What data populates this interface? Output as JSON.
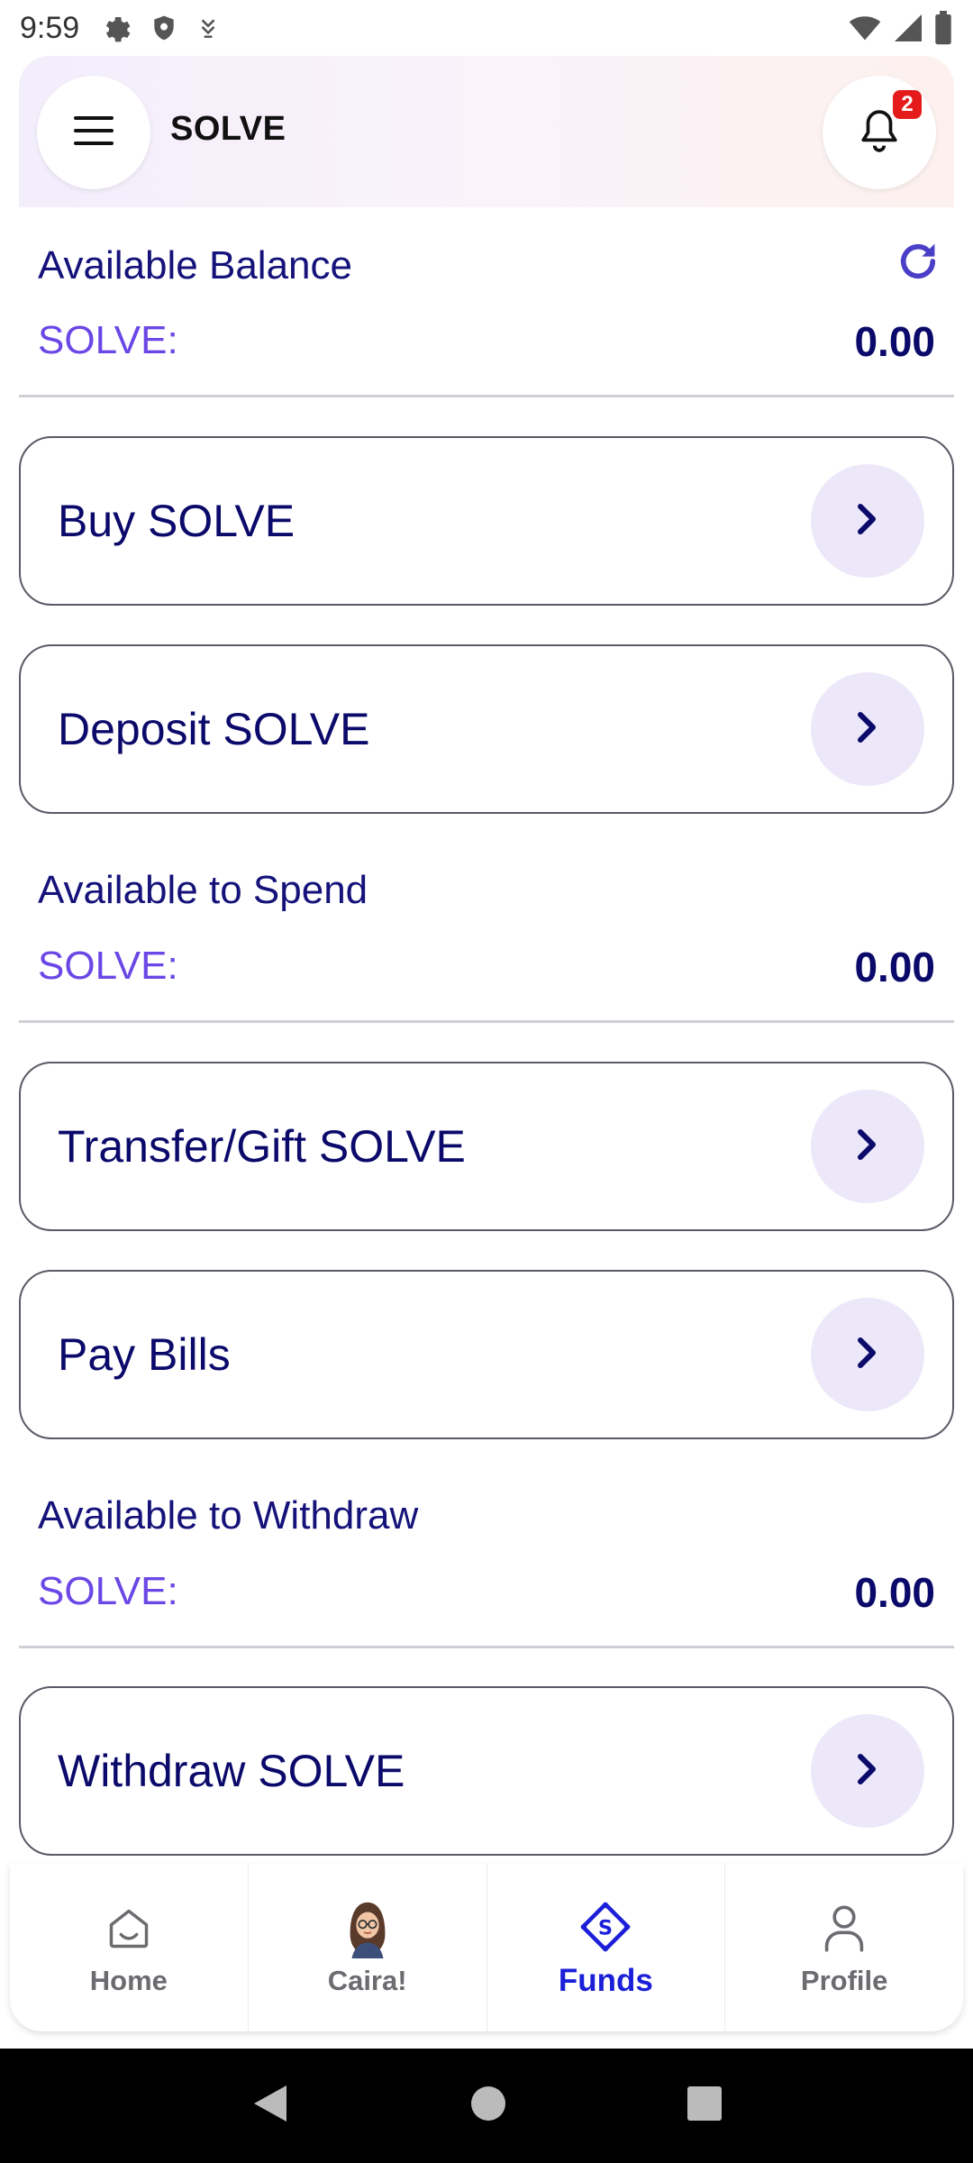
{
  "status_bar": {
    "time": "9:59",
    "left_icons": [
      "settings-icon",
      "shield-icon",
      "download-icon"
    ],
    "right_icons": [
      "wifi-icon",
      "signal-icon",
      "battery-icon"
    ]
  },
  "header": {
    "title": "SOLVE",
    "notification_count": "2",
    "menu_icon": "hamburger-menu-icon",
    "bell_icon": "bell-icon"
  },
  "sections": {
    "available_balance": {
      "title": "Available Balance",
      "currency": "SOLVE:",
      "value": "0.00"
    },
    "available_to_spend": {
      "title": "Available to Spend",
      "currency": "SOLVE:",
      "value": "0.00"
    },
    "available_to_withdraw": {
      "title": "Available to Withdraw",
      "currency": "SOLVE:",
      "value": "0.00"
    }
  },
  "actions": {
    "buy": "Buy SOLVE",
    "deposit": "Deposit SOLVE",
    "transfer": "Transfer/Gift SOLVE",
    "pay_bills": "Pay Bills",
    "withdraw": "Withdraw SOLVE"
  },
  "bottom_nav": {
    "home": "Home",
    "caira": "Caira!",
    "funds": "Funds",
    "profile": "Profile",
    "active": "Funds"
  },
  "colors": {
    "primary_text": "#0b0a6b",
    "currency_label": "#6b47e6",
    "active_nav": "#1b20d8",
    "badge": "#e51b1b",
    "arrow_bg": "#ece8f9"
  }
}
